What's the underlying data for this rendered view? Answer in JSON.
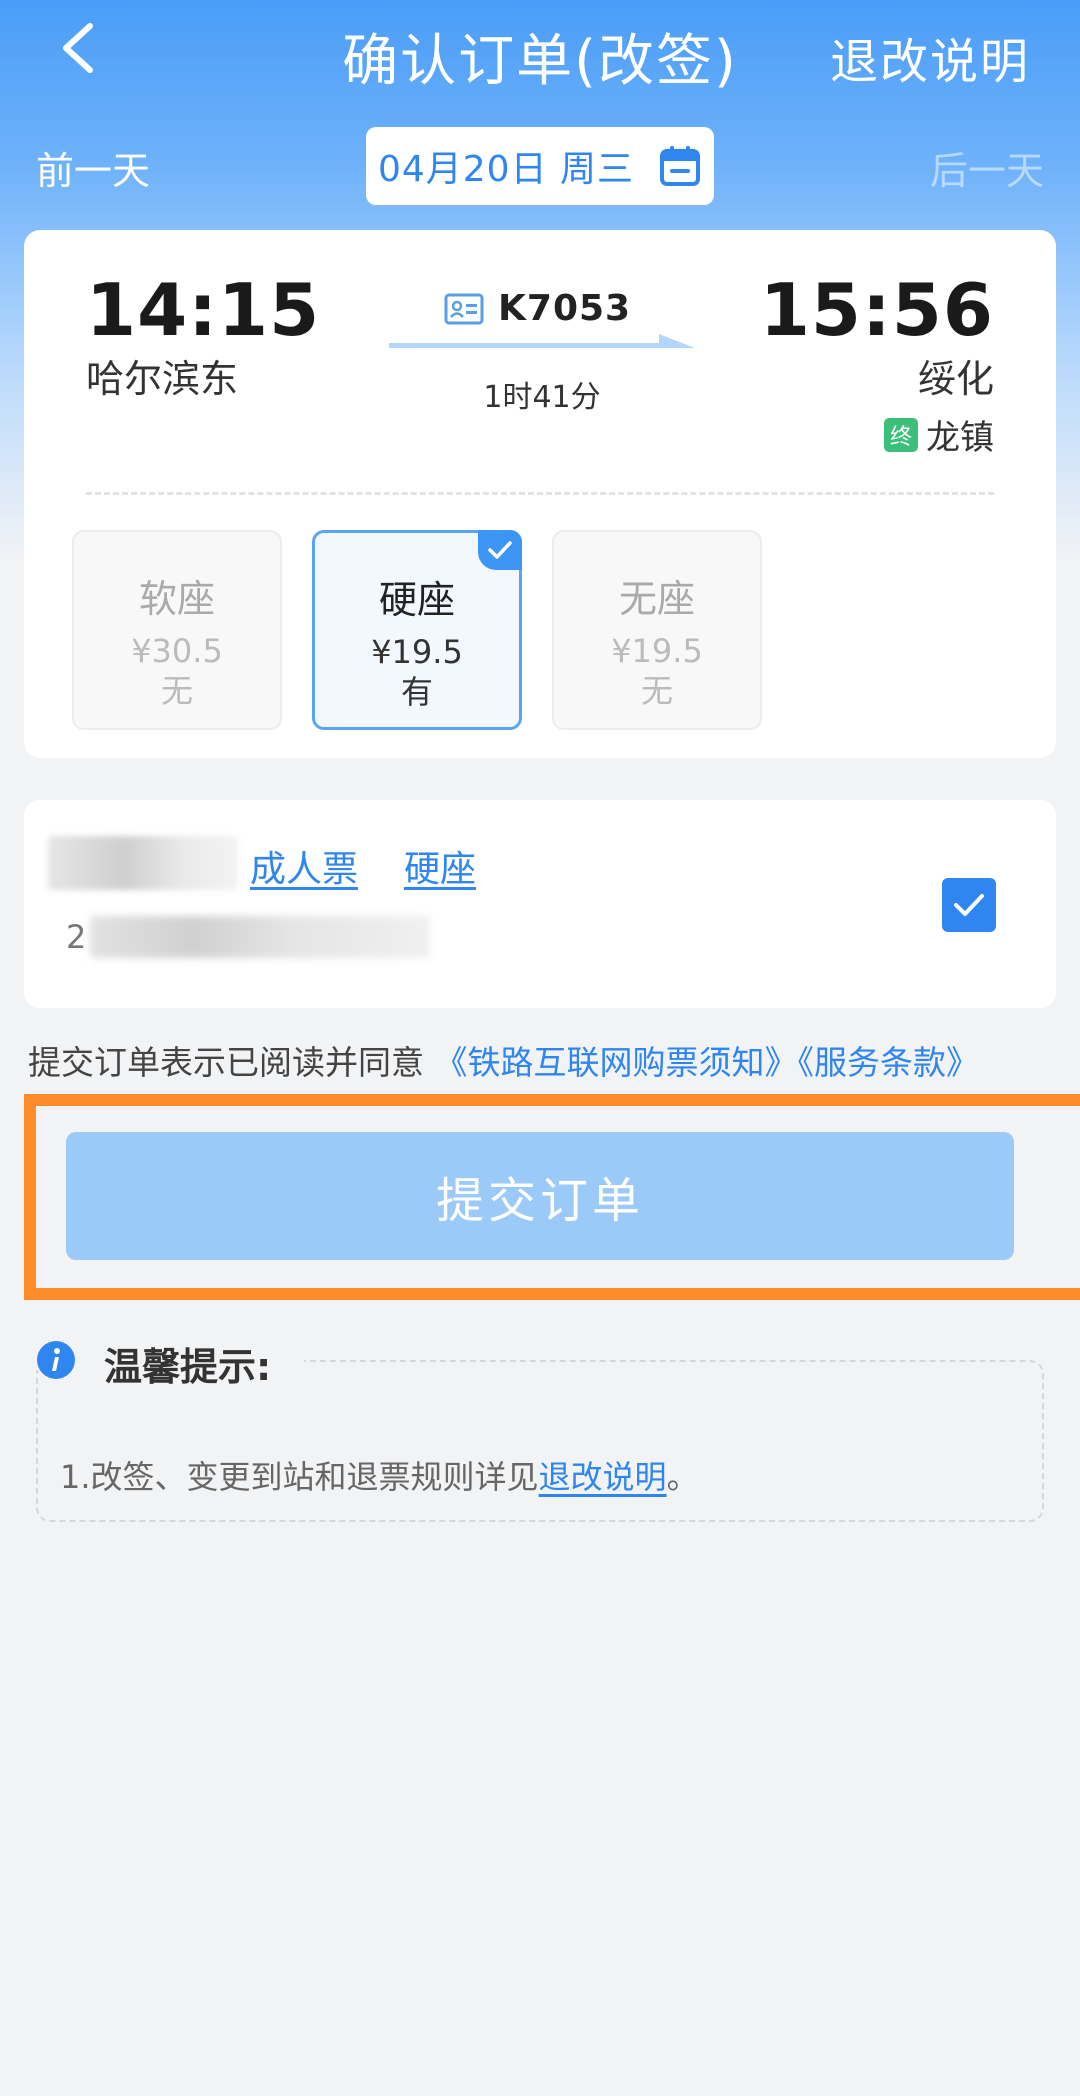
{
  "header": {
    "title": "确认订单(改签)",
    "rules_link": "退改说明"
  },
  "date_bar": {
    "prev_day": "前一天",
    "date": "04月20日 周三",
    "next_day": "后一天"
  },
  "train": {
    "departure_time": "14:15",
    "departure_station": "哈尔滨东",
    "arrival_time": "15:56",
    "arrival_station": "绥化",
    "train_no": "K7053",
    "duration": "1时41分",
    "terminal_badge": "终",
    "terminal_station": "龙镇"
  },
  "seats": [
    {
      "name": "软座",
      "price": "¥30.5",
      "availability": "无",
      "selected": false
    },
    {
      "name": "硬座",
      "price": "¥19.5",
      "availability": "有",
      "selected": true
    },
    {
      "name": "无座",
      "price": "¥19.5",
      "availability": "无",
      "selected": false
    }
  ],
  "passenger": {
    "id_prefix": "2",
    "ticket_type": "成人票",
    "seat_type": "硬座",
    "checked": true
  },
  "agreement": {
    "prefix": "提交订单表示已阅读并同意",
    "link1": "《铁路互联网购票须知》",
    "link2": "《服务条款》"
  },
  "submit": {
    "label": "提交订单"
  },
  "tips": {
    "title": "温馨提示:",
    "line_prefix": "1.改签、变更到站和退票规则详见",
    "line_link": "退改说明",
    "line_suffix": "。"
  },
  "colors": {
    "accent": "#2f86f0",
    "highlight_border": "#ff8c2a",
    "submit_disabled": "#9ccaf8",
    "terminal_badge": "#3bbf7a"
  }
}
